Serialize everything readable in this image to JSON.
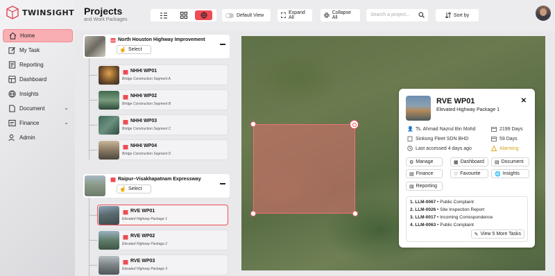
{
  "app": {
    "logo_text": "TWINSIGHTS"
  },
  "sidebar": {
    "items": [
      {
        "label": "Home",
        "icon": "home-icon",
        "active": true
      },
      {
        "label": "My Task",
        "icon": "edit-icon"
      },
      {
        "label": "Reporting",
        "icon": "report-icon"
      },
      {
        "label": "Dashboard",
        "icon": "dashboard-icon"
      },
      {
        "label": "Insights",
        "icon": "globe-icon"
      },
      {
        "label": "Document",
        "icon": "document-icon",
        "expandable": true
      },
      {
        "label": "Finance",
        "icon": "finance-icon",
        "expandable": true
      },
      {
        "label": "Admin",
        "icon": "admin-icon"
      }
    ]
  },
  "header": {
    "title": "Projects",
    "subtitle": "and Work Packages",
    "default_view_label": "Default View",
    "expand_all_label": "Expand All",
    "collapse_all_label": "Collapse All",
    "search_placeholder": "Search a project...",
    "sort_label": "Sort by"
  },
  "projects": [
    {
      "name": "North Houston Highway Improvement",
      "select_label": "Select",
      "work_packages": [
        {
          "name": "NHHI WP01",
          "desc": "Bridge Construction Segment A"
        },
        {
          "name": "NHHI WP02",
          "desc": "Bridge Construction Segment B"
        },
        {
          "name": "NHHI WP03",
          "desc": "Bridge Construction Segment C"
        },
        {
          "name": "NHHI WP04",
          "desc": "Bridge Construction Segment D"
        }
      ]
    },
    {
      "name": "Raipur–Visakhapatnam Expressway",
      "select_label": "Select",
      "work_packages": [
        {
          "name": "RVE WP01",
          "desc": "Elevated Highway Package 1",
          "active": true
        },
        {
          "name": "RVE WP02",
          "desc": "Elevated Highway Package 2"
        },
        {
          "name": "RVE WP03",
          "desc": "Elevated Highway Package 3"
        }
      ]
    }
  ],
  "popup": {
    "title": "RVE WP01",
    "subtitle": "Elevated Highway Package 1",
    "manager": "Ts. Ahmad Nazrul Bin Mohd",
    "days_total": "2199 Days",
    "contractor": "Sinkong Fleet SDN BHD",
    "days_left": "59 Days",
    "last_accessed": "Last accessed 4 days ago",
    "status": "Alarming",
    "actions": [
      "Manage",
      "Dashboard",
      "Document",
      "Finance",
      "Favourite",
      "Insights",
      "Reporting"
    ],
    "tasks": [
      {
        "num": "1.",
        "id": "LLM-0067",
        "text": "• Public Complaint"
      },
      {
        "num": "2.",
        "id": "LLM-0026",
        "text": "• Site Inspection Report"
      },
      {
        "num": "3.",
        "id": "LLM-0017",
        "text": "• Incoming Correspondence"
      },
      {
        "num": "4.",
        "id": "LLM-0063",
        "text": "• Public Complaint"
      }
    ],
    "more_tasks_label": "View 5 More Tasks"
  },
  "colors": {
    "accent": "#ef4b55",
    "active_nav": "#f8aeb3",
    "alarm": "#d9a21a"
  }
}
